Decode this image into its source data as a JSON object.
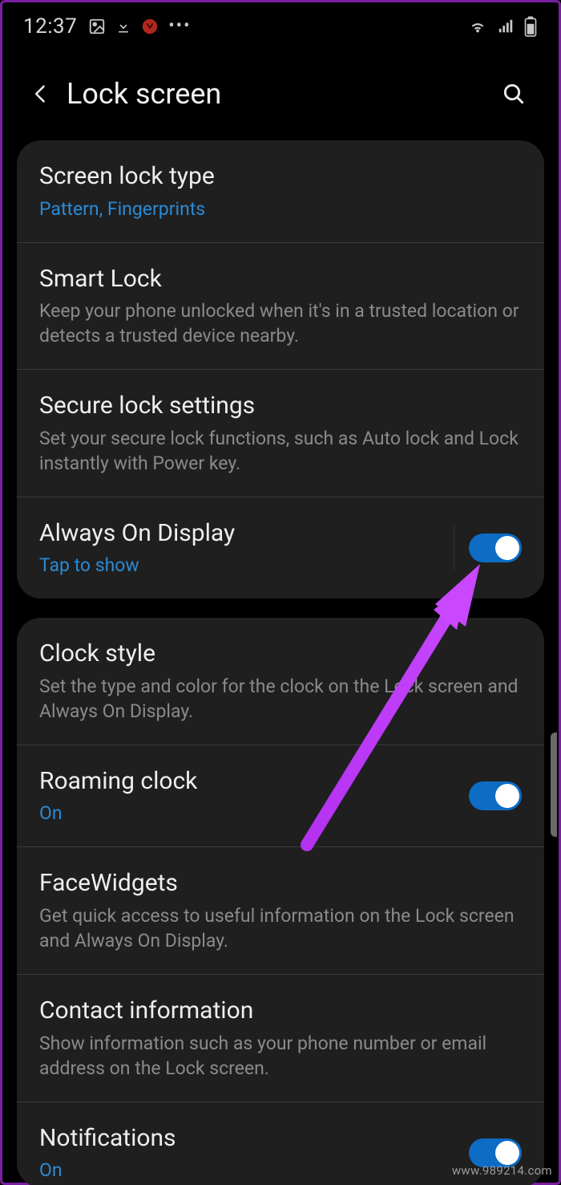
{
  "status": {
    "time": "12:37",
    "icons": {
      "image": "image-icon",
      "download": "download-icon",
      "app_badge": "app-badge-icon",
      "more": "•••",
      "wifi": "wifi-icon",
      "signal": "signal-icon",
      "battery": "battery-icon"
    }
  },
  "header": {
    "title": "Lock screen"
  },
  "groups": [
    {
      "items": [
        {
          "title": "Screen lock type",
          "subtitle": "Pattern, Fingerprints",
          "subtitle_accent": true
        },
        {
          "title": "Smart Lock",
          "subtitle": "Keep your phone unlocked when it's in a trusted location or detects a trusted device nearby."
        },
        {
          "title": "Secure lock settings",
          "subtitle": "Set your secure lock functions, such as Auto lock and Lock instantly with Power key."
        },
        {
          "title": "Always On Display",
          "subtitle": "Tap to show",
          "subtitle_accent": true,
          "toggle": true,
          "toggle_on": true,
          "separator": true
        }
      ]
    },
    {
      "items": [
        {
          "title": "Clock style",
          "subtitle": "Set the type and color for the clock on the Lock screen and Always On Display."
        },
        {
          "title": "Roaming clock",
          "subtitle": "On",
          "subtitle_accent": true,
          "toggle": true,
          "toggle_on": true
        },
        {
          "title": "FaceWidgets",
          "subtitle": "Get quick access to useful information on the Lock screen and Always On Display."
        },
        {
          "title": "Contact information",
          "subtitle": "Show information such as your phone number or email address on the Lock screen."
        },
        {
          "title": "Notifications",
          "subtitle": "On",
          "subtitle_accent": true,
          "toggle": true,
          "toggle_on": true
        }
      ]
    }
  ],
  "watermark": "www.989214.com"
}
